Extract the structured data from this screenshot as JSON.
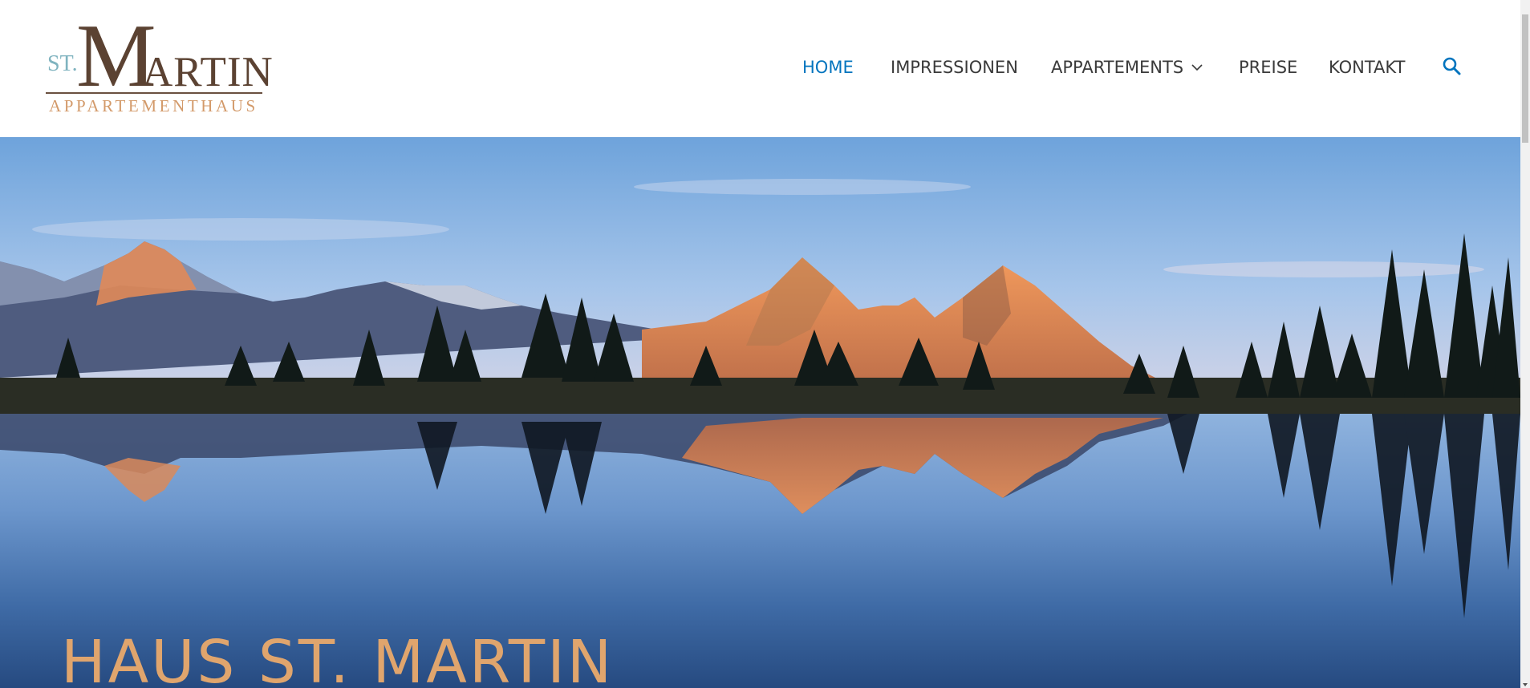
{
  "logo": {
    "st": "ST.",
    "m": "M",
    "artin": "ARTIN",
    "subtitle": "APPARTEMENTHAUS",
    "brand_brown": "#5b4232",
    "brand_gold": "#d39a6a",
    "brand_blue": "#7fb3bf"
  },
  "nav": {
    "items": [
      {
        "label": "HOME",
        "active": true
      },
      {
        "label": "IMPRESSIONEN",
        "active": false
      },
      {
        "label": "APPARTEMENTS",
        "active": false,
        "has_submenu": true
      },
      {
        "label": "PREISE",
        "active": false
      },
      {
        "label": "KONTAKT",
        "active": false
      }
    ],
    "search_icon": "search-icon",
    "submenu_icon": "chevron-down-icon",
    "active_color": "#0274be",
    "text_color": "#3a3a3a"
  },
  "hero": {
    "title": "HAUS ST. MARTIN",
    "title_color": "#e0a56d",
    "image": "alpine lake at sunset with mountain reflection"
  }
}
